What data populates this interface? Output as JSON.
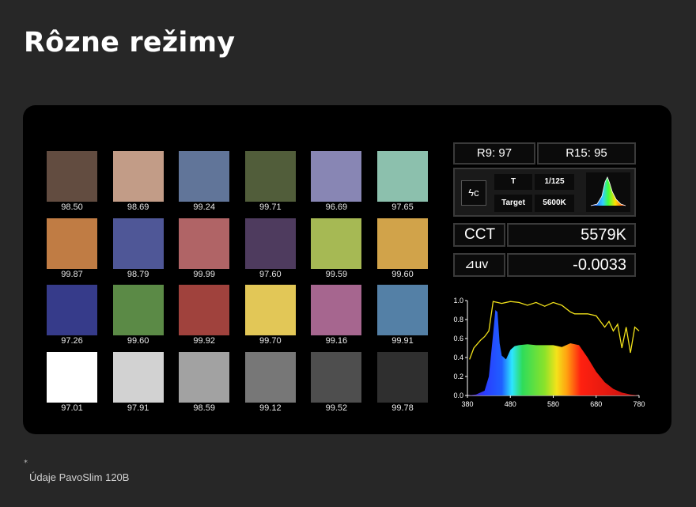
{
  "title": "Rôzne režimy",
  "swatches": [
    [
      {
        "color": "#624c40",
        "value": "98.50"
      },
      {
        "color": "#c29c87",
        "value": "98.69"
      },
      {
        "color": "#617599",
        "value": "99.24"
      },
      {
        "color": "#515d3a",
        "value": "99.71"
      },
      {
        "color": "#8886b4",
        "value": "96.69"
      },
      {
        "color": "#8cc0ad",
        "value": "97.65"
      }
    ],
    [
      {
        "color": "#c07c44",
        "value": "99.87"
      },
      {
        "color": "#4f5797",
        "value": "98.79"
      },
      {
        "color": "#b06466",
        "value": "99.99"
      },
      {
        "color": "#4e3b5e",
        "value": "97.60"
      },
      {
        "color": "#a6b954",
        "value": "99.59"
      },
      {
        "color": "#d1a34a",
        "value": "99.60"
      }
    ],
    [
      {
        "color": "#363b8a",
        "value": "97.26"
      },
      {
        "color": "#5b8a46",
        "value": "99.60"
      },
      {
        "color": "#a0423d",
        "value": "99.92"
      },
      {
        "color": "#e2c757",
        "value": "99.70"
      },
      {
        "color": "#a6668f",
        "value": "99.16"
      },
      {
        "color": "#5480a6",
        "value": "99.91"
      }
    ],
    [
      {
        "color": "#ffffff",
        "value": "97.01"
      },
      {
        "color": "#d2d2d2",
        "value": "97.91"
      },
      {
        "color": "#a2a2a2",
        "value": "98.59"
      },
      {
        "color": "#777777",
        "value": "99.12"
      },
      {
        "color": "#4e4e4e",
        "value": "99.52"
      },
      {
        "color": "#2f2f2f",
        "value": "99.78"
      }
    ]
  ],
  "meter": {
    "r9": "R9: 97",
    "r15": "R15: 95",
    "mode_icon": "ϟc",
    "t_label": "T",
    "t_value": "1/125",
    "target_label": "Target",
    "target_value": "5600K",
    "cct_label": "CCT",
    "cct_value": "5579K",
    "duv_label": "⊿uv",
    "duv_value": "-0.0033"
  },
  "chart_data": {
    "type": "area",
    "x_ticks": [
      380,
      480,
      580,
      680,
      780
    ],
    "y_ticks": [
      "0.0",
      "0.2",
      "0.4",
      "0.6",
      "0.8",
      "1.0"
    ],
    "xlim": [
      380,
      780
    ],
    "ylim": [
      0,
      1
    ],
    "series": [
      {
        "x": [
          380,
          400,
          420,
          430,
          440,
          445,
          450,
          455,
          460,
          470,
          480,
          490,
          500,
          520,
          540,
          560,
          580,
          600,
          620,
          640,
          660,
          680,
          700,
          720,
          740,
          760,
          780
        ],
        "y": [
          0.0,
          0.01,
          0.05,
          0.2,
          0.65,
          0.9,
          0.88,
          0.55,
          0.42,
          0.38,
          0.48,
          0.52,
          0.53,
          0.54,
          0.53,
          0.53,
          0.53,
          0.51,
          0.55,
          0.53,
          0.4,
          0.25,
          0.14,
          0.07,
          0.03,
          0.01,
          0.0
        ]
      },
      {
        "x": [
          385,
          395,
          410,
          420,
          430,
          440,
          450,
          460,
          480,
          500,
          520,
          540,
          560,
          580,
          600,
          620,
          630,
          640,
          660,
          680,
          700,
          710,
          720,
          730,
          740,
          750,
          760,
          770,
          780
        ],
        "y": [
          0.38,
          0.5,
          0.58,
          0.62,
          0.68,
          0.99,
          0.98,
          0.97,
          0.99,
          0.98,
          0.95,
          0.98,
          0.94,
          0.98,
          0.95,
          0.88,
          0.86,
          0.86,
          0.86,
          0.84,
          0.72,
          0.78,
          0.68,
          0.75,
          0.5,
          0.72,
          0.45,
          0.72,
          0.68
        ]
      }
    ]
  }
}
